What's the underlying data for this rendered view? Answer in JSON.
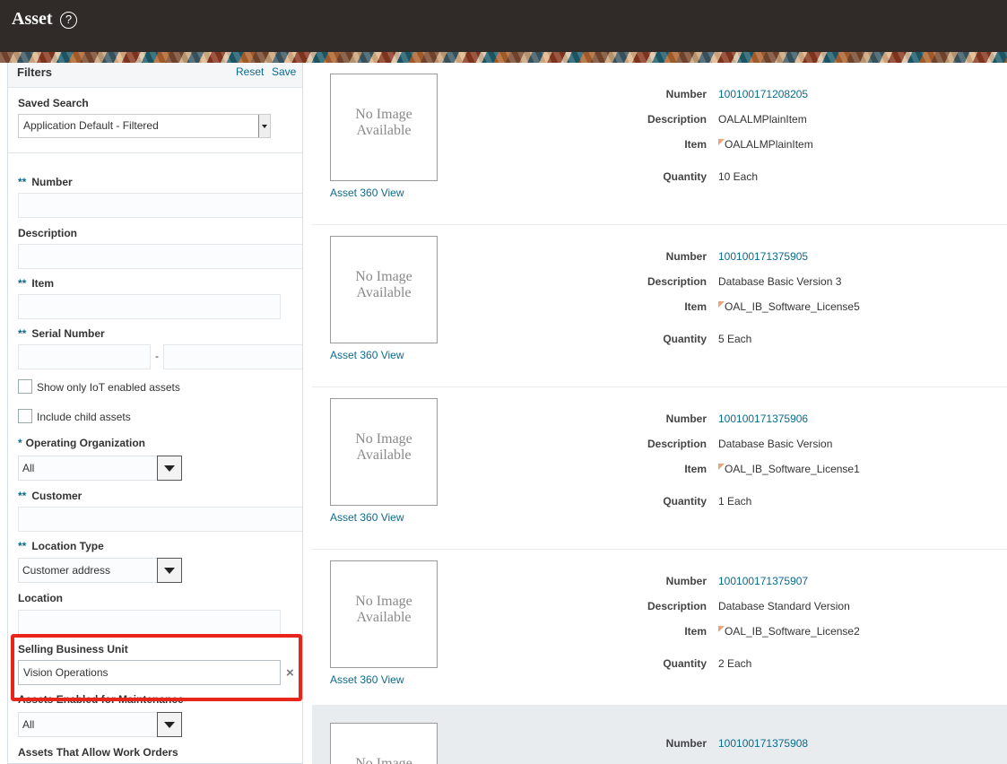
{
  "header": {
    "title": "Asset",
    "help_glyph": "?"
  },
  "filters": {
    "title": "Filters",
    "reset_label": "Reset",
    "save_label": "Save",
    "saved_search": {
      "label": "Saved Search",
      "value": "Application Default - Filtered"
    },
    "required_marker": "**",
    "single_required_marker": "*",
    "number": {
      "label": "Number",
      "value": ""
    },
    "description": {
      "label": "Description",
      "value": ""
    },
    "item": {
      "label": "Item",
      "value": ""
    },
    "serial_number": {
      "label": "Serial Number",
      "separator": "-"
    },
    "iot_checkbox": {
      "label": "Show only IoT enabled assets",
      "checked": false
    },
    "child_checkbox": {
      "label": "Include child assets",
      "checked": false
    },
    "operating_org": {
      "label": "Operating Organization",
      "value": "All"
    },
    "customer": {
      "label": "Customer",
      "value": ""
    },
    "location_type": {
      "label": "Location Type",
      "value": "Customer address"
    },
    "location": {
      "label": "Location",
      "value": ""
    },
    "selling_bu": {
      "label": "Selling Business Unit",
      "value": "Vision Operations",
      "clear_glyph": "×"
    },
    "maintenance": {
      "label": "Assets Enabled for Maintenance",
      "value": "All"
    },
    "work_orders": {
      "label": "Assets That Allow Work Orders"
    }
  },
  "results": {
    "no_image_text": "No Image Available",
    "view_link": "Asset 360 View",
    "labels": {
      "number": "Number",
      "description": "Description",
      "item": "Item",
      "quantity": "Quantity"
    },
    "assets": [
      {
        "number": "100100171208205",
        "description": "OALALMPlainItem",
        "item": "OALALMPlainItem",
        "quantity": "10 Each"
      },
      {
        "number": "100100171375905",
        "description": "Database Basic Version 3",
        "item": "OAL_IB_Software_License5",
        "quantity": "5 Each"
      },
      {
        "number": "100100171375906",
        "description": "Database Basic Version",
        "item": "OAL_IB_Software_License1",
        "quantity": "1 Each"
      },
      {
        "number": "100100171375907",
        "description": "Database Standard Version",
        "item": "OAL_IB_Software_License2",
        "quantity": "2 Each"
      },
      {
        "number": "100100171375908",
        "description": "",
        "item": "",
        "quantity": ""
      }
    ]
  },
  "colors": {
    "accent": "#0b6b8c",
    "header_bg": "#302b28",
    "highlight": "#e8251b"
  }
}
